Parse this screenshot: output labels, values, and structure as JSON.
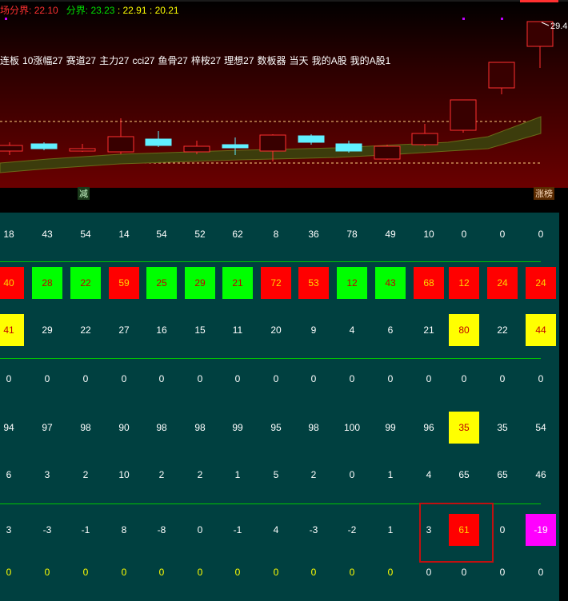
{
  "header": {
    "seg1_label": "场分界:",
    "seg1_value": "22.10",
    "seg2_label": "分界:",
    "seg2_value": "23.23",
    "sep1": ":",
    "seg3_value": "22.91",
    "sep2": ":",
    "seg4_value": "20.21",
    "price_label": "29.4",
    "tag_left": "减",
    "tag_right": "涨榜"
  },
  "toolbar": {
    "items": [
      "连板",
      "10涨幅27",
      "赛道27",
      "主力27",
      "cci27",
      "鱼骨27",
      "梓桉27",
      "理想27",
      "数板器",
      "当天",
      "我的A股",
      "我的A股1"
    ]
  },
  "colors": {
    "up": "#ff3030",
    "down": "#60f0ff",
    "green": "#00ff00",
    "yellow": "#ffff00",
    "panel": "#004040"
  },
  "grid": {
    "rows": [
      {
        "cells": [
          {
            "v": "18"
          },
          {
            "v": "43"
          },
          {
            "v": "54"
          },
          {
            "v": "14"
          },
          {
            "v": "54"
          },
          {
            "v": "52"
          },
          {
            "v": "62"
          },
          {
            "v": "8"
          },
          {
            "v": "36"
          },
          {
            "v": "78"
          },
          {
            "v": "49"
          },
          {
            "v": "10"
          },
          {
            "v": "0"
          },
          {
            "v": "0"
          },
          {
            "v": "0"
          }
        ]
      },
      {
        "cells": [
          {
            "v": "40",
            "bg": "red"
          },
          {
            "v": "28",
            "bg": "green"
          },
          {
            "v": "22",
            "bg": "green"
          },
          {
            "v": "59",
            "bg": "red"
          },
          {
            "v": "25",
            "bg": "green"
          },
          {
            "v": "29",
            "bg": "green"
          },
          {
            "v": "21",
            "bg": "green"
          },
          {
            "v": "72",
            "bg": "red"
          },
          {
            "v": "53",
            "bg": "red"
          },
          {
            "v": "12",
            "bg": "green"
          },
          {
            "v": "43",
            "bg": "green"
          },
          {
            "v": "68",
            "bg": "red"
          },
          {
            "v": "12",
            "bg": "red"
          },
          {
            "v": "24",
            "bg": "red"
          },
          {
            "v": "24",
            "bg": "red"
          }
        ]
      },
      {
        "cells": [
          {
            "v": "41",
            "bg": "yellow"
          },
          {
            "v": "29"
          },
          {
            "v": "22"
          },
          {
            "v": "27"
          },
          {
            "v": "16"
          },
          {
            "v": "15"
          },
          {
            "v": "11"
          },
          {
            "v": "20"
          },
          {
            "v": "9"
          },
          {
            "v": "4"
          },
          {
            "v": "6"
          },
          {
            "v": "21"
          },
          {
            "v": "80",
            "bg": "yellow"
          },
          {
            "v": "22"
          },
          {
            "v": "44",
            "bg": "yellow"
          }
        ]
      },
      {
        "cells": [
          {
            "v": "0"
          },
          {
            "v": "0"
          },
          {
            "v": "0"
          },
          {
            "v": "0"
          },
          {
            "v": "0"
          },
          {
            "v": "0"
          },
          {
            "v": "0"
          },
          {
            "v": "0"
          },
          {
            "v": "0"
          },
          {
            "v": "0"
          },
          {
            "v": "0"
          },
          {
            "v": "0"
          },
          {
            "v": "0"
          },
          {
            "v": "0"
          },
          {
            "v": "0"
          }
        ]
      },
      {
        "cells": [
          {
            "v": "94"
          },
          {
            "v": "97"
          },
          {
            "v": "98"
          },
          {
            "v": "90"
          },
          {
            "v": "98"
          },
          {
            "v": "98"
          },
          {
            "v": "99"
          },
          {
            "v": "95"
          },
          {
            "v": "98"
          },
          {
            "v": "100"
          },
          {
            "v": "99"
          },
          {
            "v": "96"
          },
          {
            "v": "35",
            "bg": "yellow"
          },
          {
            "v": "35"
          },
          {
            "v": "54"
          }
        ]
      },
      {
        "cells": [
          {
            "v": "6"
          },
          {
            "v": "3"
          },
          {
            "v": "2"
          },
          {
            "v": "10"
          },
          {
            "v": "2"
          },
          {
            "v": "2"
          },
          {
            "v": "1"
          },
          {
            "v": "5"
          },
          {
            "v": "2"
          },
          {
            "v": "0"
          },
          {
            "v": "1"
          },
          {
            "v": "4"
          },
          {
            "v": "65"
          },
          {
            "v": "65"
          },
          {
            "v": "46"
          }
        ]
      },
      {
        "cells": [
          {
            "v": "3"
          },
          {
            "v": "-3"
          },
          {
            "v": "-1"
          },
          {
            "v": "8"
          },
          {
            "v": "-8"
          },
          {
            "v": "0"
          },
          {
            "v": "-1"
          },
          {
            "v": "4"
          },
          {
            "v": "-3"
          },
          {
            "v": "-2"
          },
          {
            "v": "1"
          },
          {
            "v": "3"
          },
          {
            "v": "61",
            "bg": "red"
          },
          {
            "v": "0"
          },
          {
            "v": "-19",
            "bg": "magenta"
          }
        ]
      },
      {
        "cells": [
          {
            "v": "0",
            "fg": "yellow"
          },
          {
            "v": "0",
            "fg": "yellow"
          },
          {
            "v": "0",
            "fg": "yellow"
          },
          {
            "v": "0",
            "fg": "yellow"
          },
          {
            "v": "0",
            "fg": "yellow"
          },
          {
            "v": "0",
            "fg": "yellow"
          },
          {
            "v": "0",
            "fg": "yellow"
          },
          {
            "v": "0",
            "fg": "yellow"
          },
          {
            "v": "0",
            "fg": "yellow"
          },
          {
            "v": "0",
            "fg": "yellow"
          },
          {
            "v": "0",
            "fg": "yellow"
          },
          {
            "v": "0"
          },
          {
            "v": "0"
          },
          {
            "v": "0"
          },
          {
            "v": "0"
          }
        ]
      }
    ]
  }
}
